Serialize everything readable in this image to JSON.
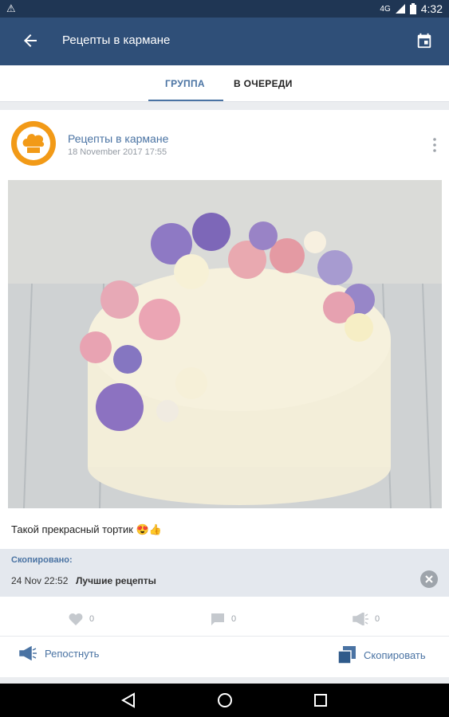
{
  "status_bar": {
    "time": "4:32",
    "network": "4G"
  },
  "app_bar": {
    "title": "Рецепты в кармане"
  },
  "tabs": [
    {
      "label": "ГРУППА",
      "active": true
    },
    {
      "label": "В ОЧЕРЕДИ",
      "active": false
    }
  ],
  "post": {
    "author": "Рецепты в кармане",
    "date": "18 November 2017  17:55",
    "text": "Такой прекрасный тортик 😍👍"
  },
  "copied": {
    "label": "Скопировано:",
    "time": "24 Nov 22:52",
    "source": "Лучшие рецепты"
  },
  "stats": {
    "likes": "0",
    "comments": "0",
    "reposts": "0"
  },
  "actions": {
    "repost": "Репостнуть",
    "copy": "Скопировать"
  },
  "colors": {
    "header": "#2f4f78",
    "accent": "#4a73a3",
    "avatar": "#f29a17"
  }
}
